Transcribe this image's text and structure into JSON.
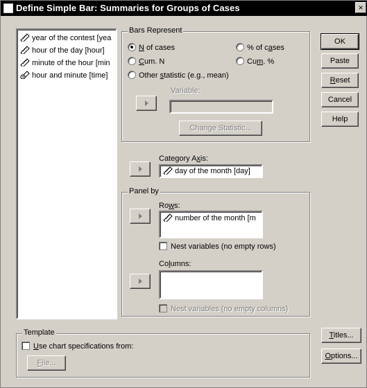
{
  "window": {
    "title": "Define Simple Bar: Summaries for Groups of Cases",
    "close_glyph": "×"
  },
  "variables": [
    {
      "label": "year of the contest [yea",
      "icon": "ruler-icon"
    },
    {
      "label": "hour of the day [hour]",
      "icon": "ruler-icon"
    },
    {
      "label": "minute of the hour [min",
      "icon": "ruler-icon"
    },
    {
      "label": "hour and minute [time]",
      "icon": "date-ruler-icon"
    }
  ],
  "bars_represent": {
    "label": "Bars Represent",
    "options": {
      "n_of_cases": {
        "prefix": "",
        "mnemonic": "N",
        "suffix": " of cases",
        "selected": true
      },
      "pct_of_cases": {
        "prefix": "% of c",
        "mnemonic": "a",
        "suffix": "ses",
        "selected": false
      },
      "cum_n": {
        "prefix": "",
        "mnemonic": "C",
        "suffix": "um. N",
        "selected": false
      },
      "cum_pct": {
        "prefix": "Cu",
        "mnemonic": "m",
        "suffix": ". %",
        "selected": false
      },
      "other_statistic": {
        "prefix": "Other ",
        "mnemonic": "s",
        "suffix": "tatistic (e.g., mean)",
        "selected": false
      }
    },
    "variable_label": "Variable:",
    "variable_value": "",
    "change_statistic": "Change Statistic..."
  },
  "category_axis": {
    "prefix": "Category A",
    "mnemonic": "x",
    "suffix": "is:",
    "value": "day of the month [day]"
  },
  "panel_by": {
    "label": "Panel by",
    "rows_prefix": "Ro",
    "rows_mnemonic": "w",
    "rows_suffix": "s:",
    "rows_value": "number of the month [m",
    "nest_rows": "Nest variables (no empty rows)",
    "columns_prefix": "Co",
    "columns_mnemonic": "l",
    "columns_suffix": "umns:",
    "columns_value": "",
    "nest_columns": "Nest variables (no empty columns)"
  },
  "template": {
    "label": "Template",
    "use_prefix": "",
    "use_mnemonic": "U",
    "use_suffix": "se chart specifications from:",
    "file_prefix": "",
    "file_mnemonic": "F",
    "file_suffix": "ile..."
  },
  "buttons": {
    "ok": "OK",
    "paste": "Paste",
    "reset_mnemonic": "R",
    "reset_suffix": "eset",
    "cancel": "Cancel",
    "help": "Help",
    "titles_mnemonic": "T",
    "titles_suffix": "itles...",
    "options_mnemonic": "O",
    "options_suffix": "ptions..."
  }
}
